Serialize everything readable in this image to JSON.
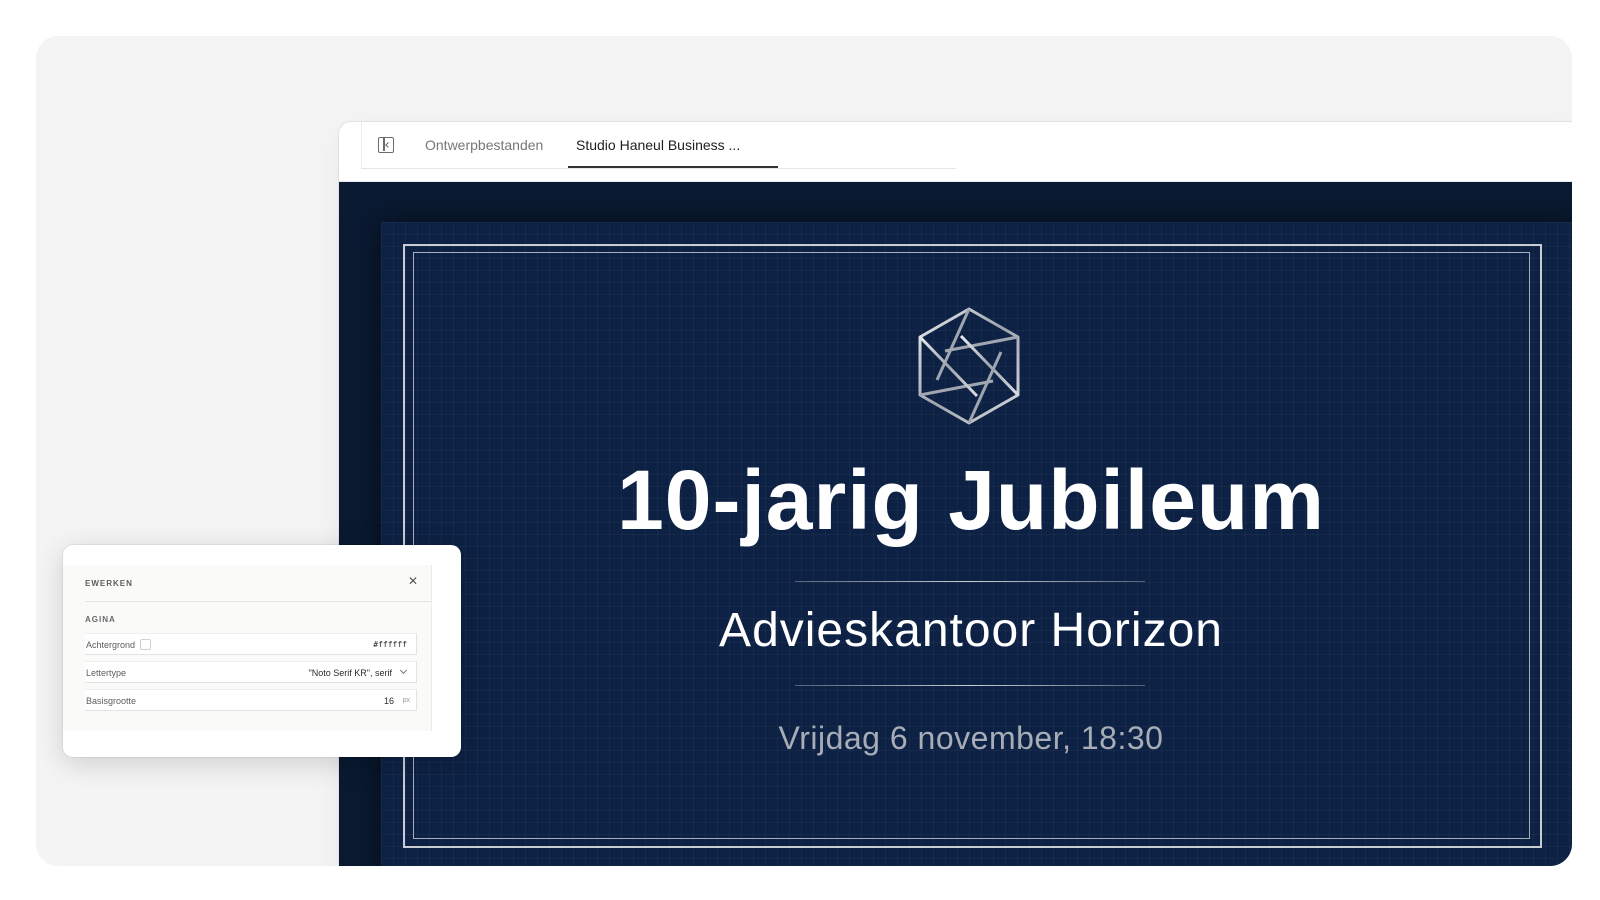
{
  "tabs": {
    "items": [
      {
        "label": "Ontwerpbestanden"
      },
      {
        "label": "Studio Haneul Business ..."
      }
    ],
    "active_index": 1
  },
  "slide": {
    "title": "10-jarig Jubileum",
    "subtitle": "Advieskantoor Horizon",
    "date": "Vrijdag 6 november, 18:30",
    "colors": {
      "background": "#0d2144",
      "text": "#ffffff",
      "frame": "#c9ccd2",
      "date_text": "#a7adb6"
    }
  },
  "edit_panel": {
    "header": "EWERKEN",
    "section": "AGINA",
    "properties": [
      {
        "label": "Achtergrond",
        "value": "#ffffff"
      },
      {
        "label": "Lettertype",
        "value": "\"Noto Serif KR\", serif"
      },
      {
        "label": "Basisgrootte",
        "value": "16",
        "unit": "px"
      }
    ]
  }
}
